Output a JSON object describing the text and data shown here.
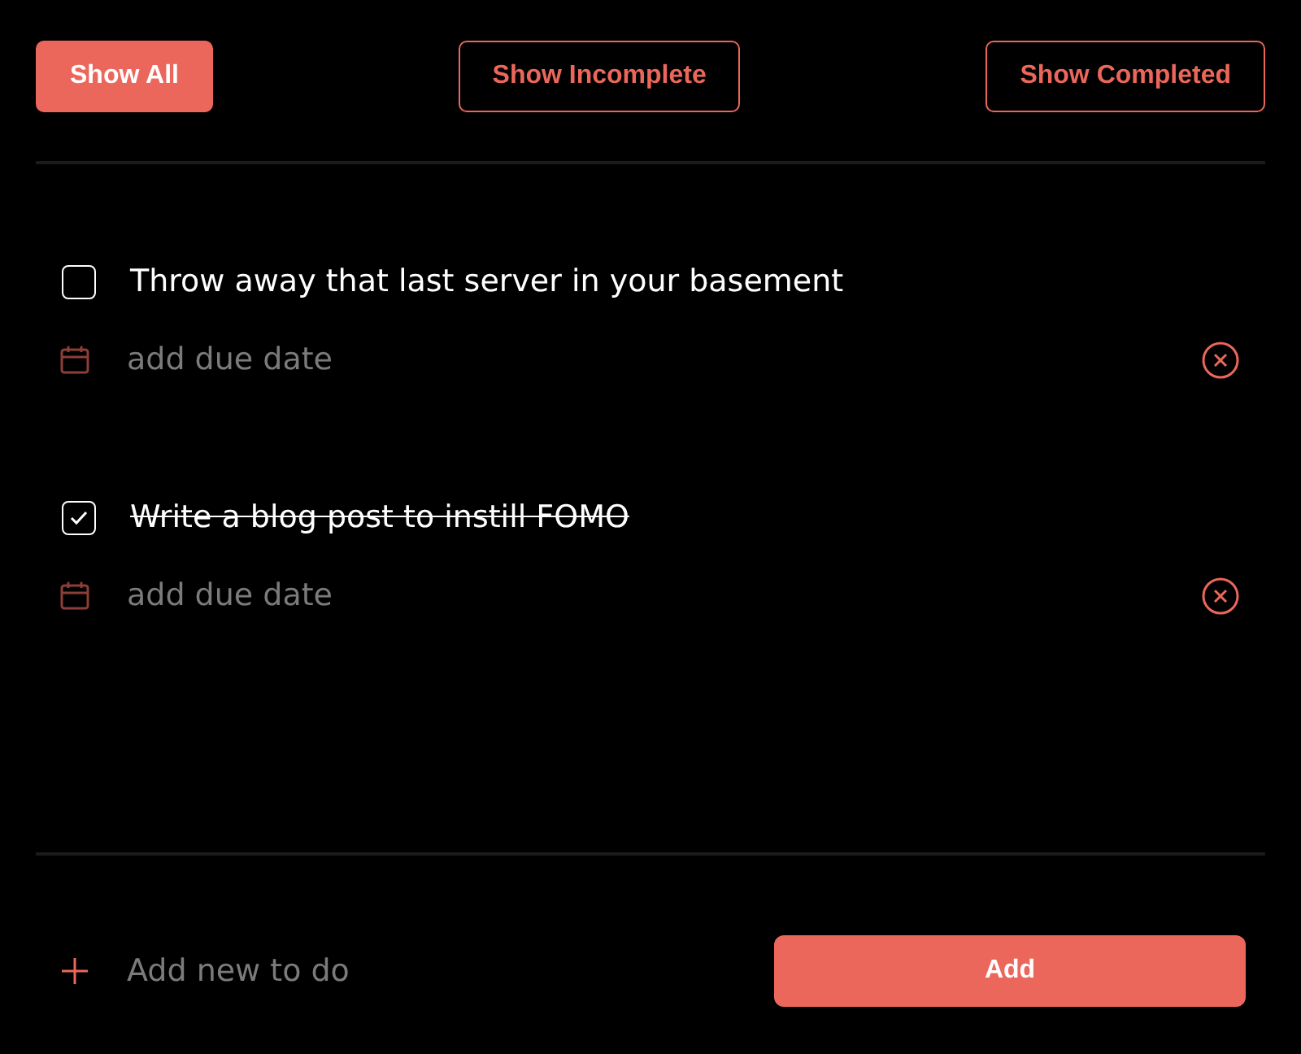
{
  "filters": [
    {
      "label": "Show All",
      "selected": true
    },
    {
      "label": "Show Incomplete",
      "selected": false
    },
    {
      "label": "Show Completed",
      "selected": false
    }
  ],
  "todos": [
    {
      "text": "Throw away that last server in your basement",
      "checked": false,
      "due_date": {
        "placeholder": "add due date"
      }
    },
    {
      "text": "Write a blog post to instill FOMO",
      "checked": true,
      "due_date": {
        "placeholder": "add due date"
      }
    }
  ],
  "new_todo": {
    "placeholder": "Add new to do"
  },
  "add_button": {
    "label": "Add"
  }
}
